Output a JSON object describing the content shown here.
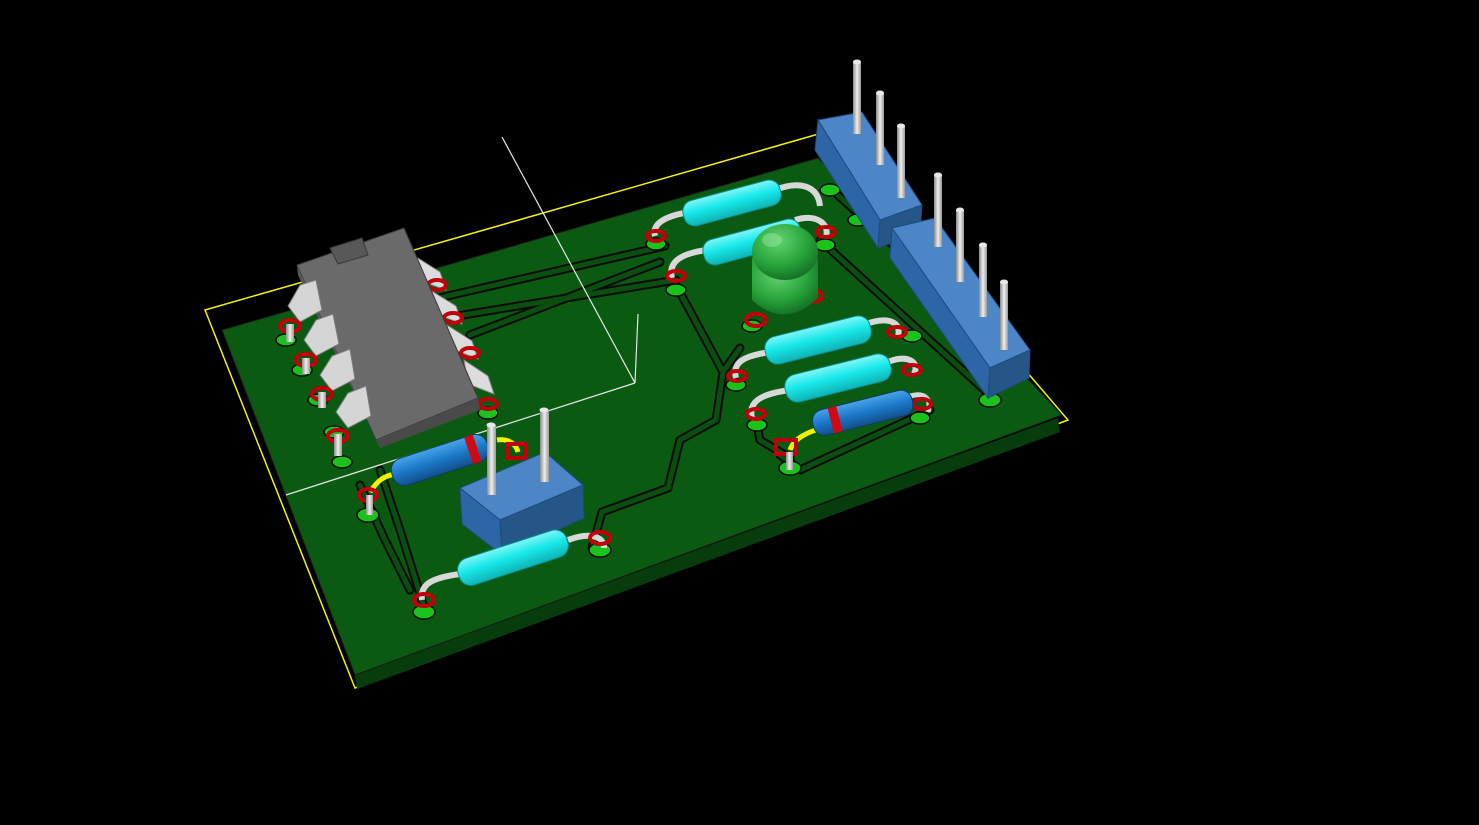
{
  "viewer": {
    "background": "#000000",
    "board_color": "#0b5a12",
    "board_edge_color": "#073d0c",
    "outline_color": "#f4f400",
    "trace_color": "#0a4e10",
    "trace_outline": "#0c0c0c",
    "pad_ring_color": "#c0000a",
    "pad_green_color": "#19c31a",
    "resistor_body_color": "#17e9ea",
    "diode_body_color": "#1a78c8",
    "diode_band_color": "#d00a12",
    "ic_body_color": "#666666",
    "header_body_color": "#2d66a6",
    "pin_color": "#c7c7c7",
    "led_color": "#27a23a",
    "lead_color": "#d8d8d8",
    "lead_yellow": "#f2f200",
    "axis_color": "#e6e6e6"
  },
  "components": {
    "ic": "dip8-ic",
    "diodes": [
      "diode-left",
      "diode-right"
    ],
    "resistors": [
      "resistor-top-1",
      "resistor-top-2",
      "resistor-mid-1",
      "resistor-mid-2",
      "resistor-bottom"
    ],
    "led": "led-green",
    "headers": [
      "header-2pin",
      "header-3pin-top",
      "header-4pin-right"
    ]
  }
}
